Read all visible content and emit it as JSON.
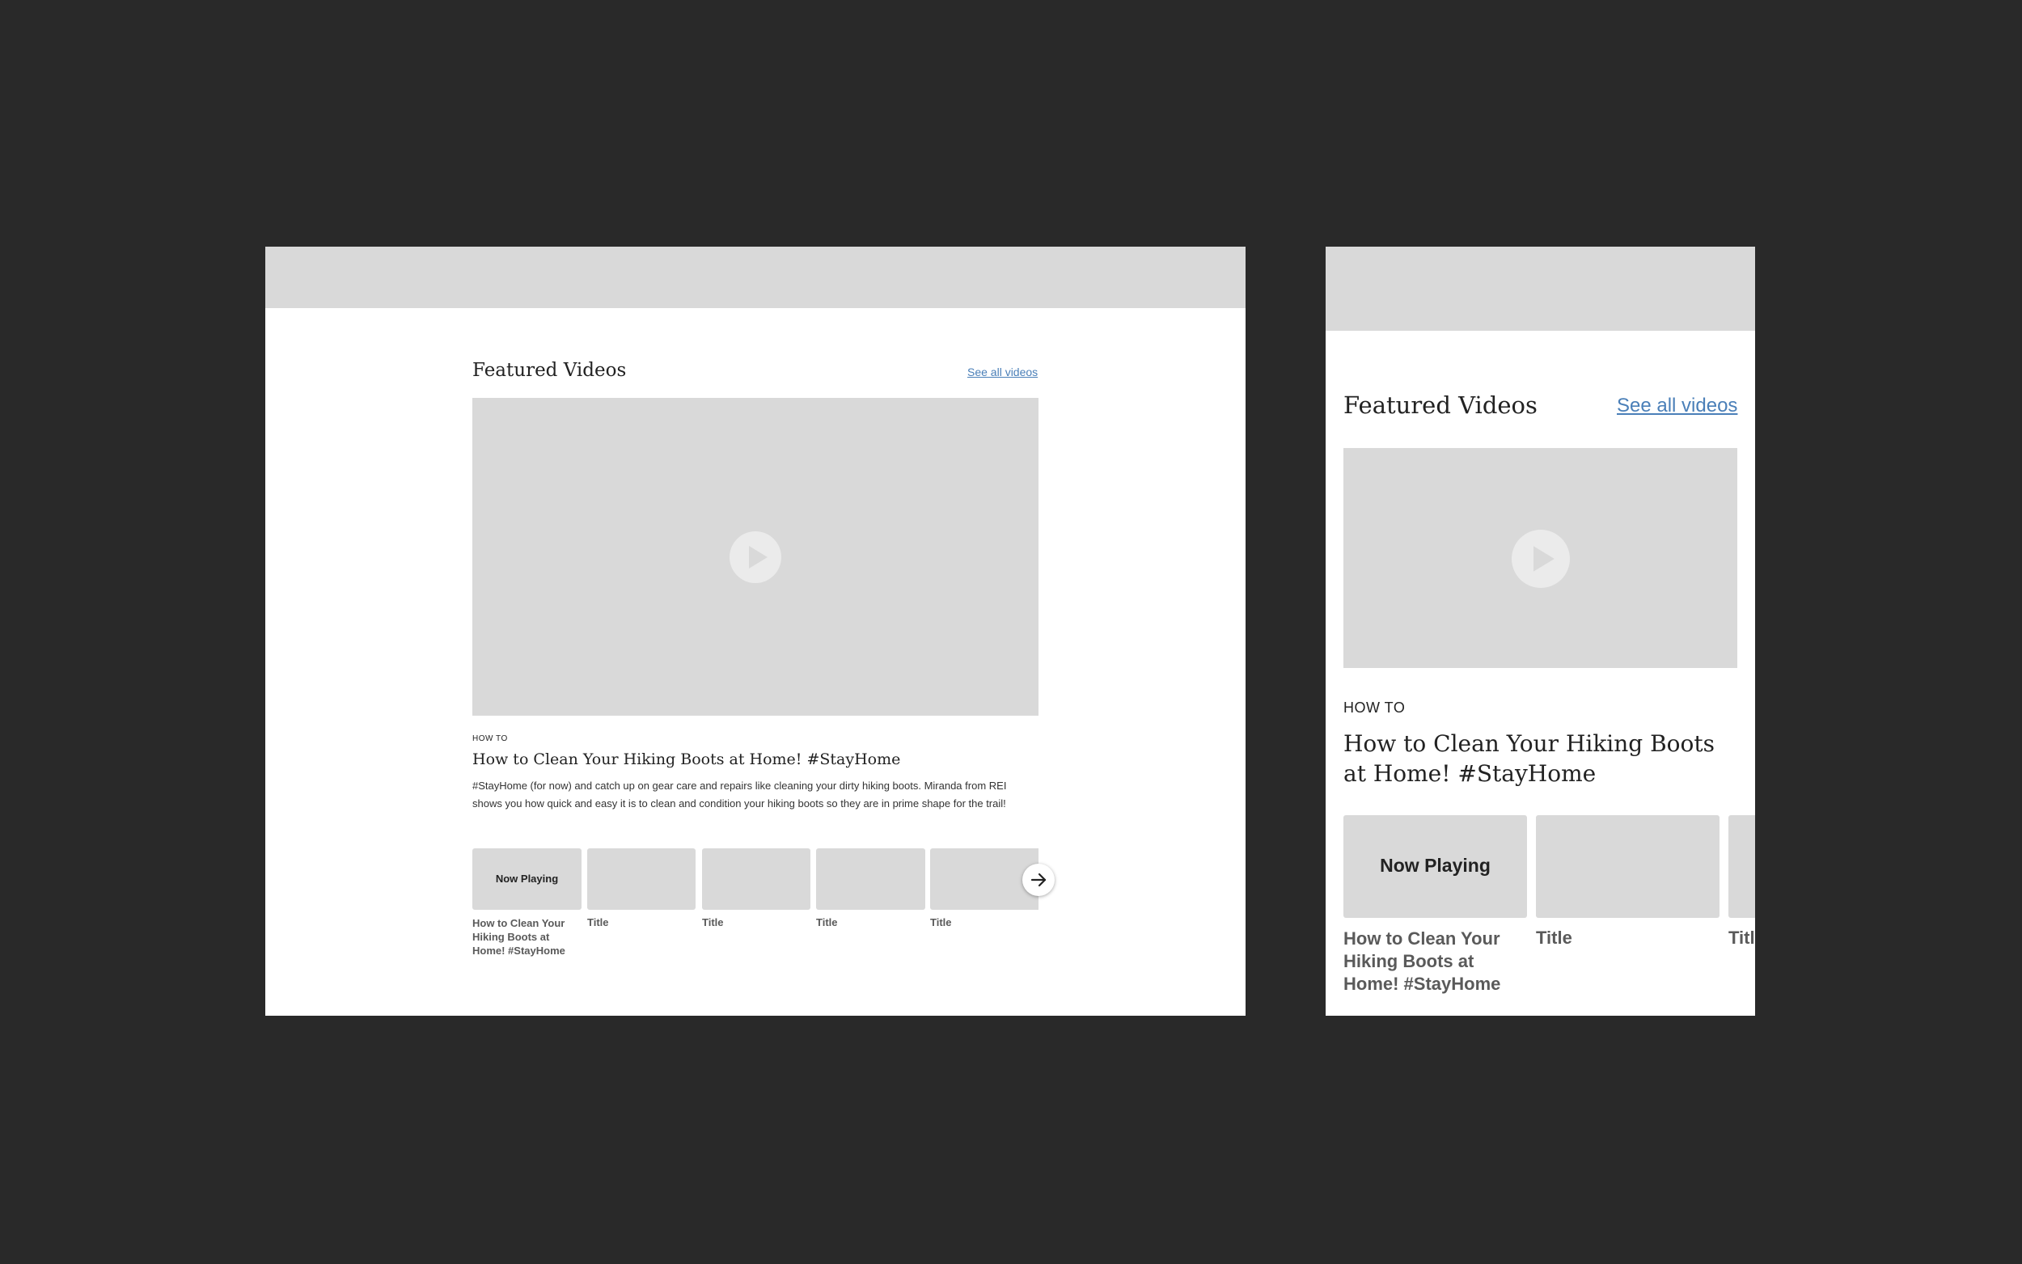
{
  "desktop": {
    "heading": "Featured Videos",
    "see_all": "See all videos",
    "category": "HOW TO",
    "video_title": "How to Clean Your Hiking Boots at Home! #StayHome",
    "description": "#StayHome (for now) and catch up on gear care and repairs like cleaning your dirty hiking boots. Miranda from REI shows you how quick and easy it is to clean and condition your hiking boots so they are in prime shape for the trail!",
    "thumbs": [
      {
        "overlay": "Now Playing",
        "caption": "How to Clean Your Hiking Boots at Home! #StayHome"
      },
      {
        "overlay": "",
        "caption": "Title"
      },
      {
        "overlay": "",
        "caption": "Title"
      },
      {
        "overlay": "",
        "caption": "Title"
      },
      {
        "overlay": "",
        "caption": "Title"
      }
    ]
  },
  "mobile": {
    "heading": "Featured Videos",
    "see_all": "See all videos",
    "category": "HOW TO",
    "video_title": "How to Clean Your Hiking Boots at Home! #StayHome",
    "thumbs": [
      {
        "overlay": "Now Playing",
        "caption": "How to Clean Your Hiking Boots at Home! #StayHome"
      },
      {
        "overlay": "",
        "caption": "Title"
      },
      {
        "overlay": "",
        "caption": "Title"
      }
    ]
  },
  "icons": {
    "play": "play-icon",
    "next": "arrow-right-icon"
  },
  "colors": {
    "background": "#292929",
    "placeholder": "#d9d9d9",
    "link": "#4a7fb8"
  }
}
